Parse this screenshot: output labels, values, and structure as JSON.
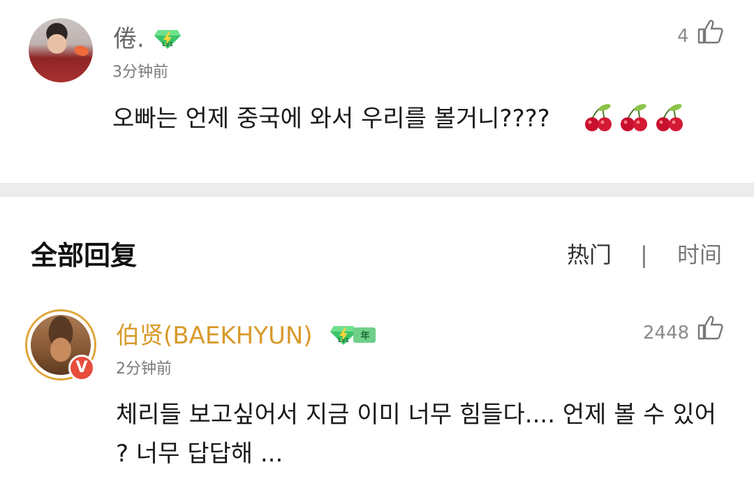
{
  "top_comment": {
    "username": "倦.",
    "level_badge": "Lv1",
    "time": "3分钟前",
    "like_count": "4",
    "text": "오빠는 언제 중국에 와서 우리를 볼거니????",
    "emoji": [
      "cherry-emoji",
      "cherry-emoji",
      "cherry-emoji"
    ]
  },
  "replies_section": {
    "title": "全部回复",
    "sort_hot": "热门",
    "sort_separator": "|",
    "sort_time": "时间"
  },
  "reply": {
    "username": "伯贤(BAEKHYUN)",
    "level_badge": "Lv1",
    "year_badge": "年",
    "verified": "V",
    "time": "2分钟前",
    "like_count": "2448",
    "text": "체리들 보고싶어서 지금 이미 너무 힘들다.... 언제 볼 수 있어 ? 너무 답답해 ..."
  },
  "colors": {
    "reply_name": "#d89a2b",
    "verified_badge": "#e74c3c",
    "divider": "#ececec"
  }
}
